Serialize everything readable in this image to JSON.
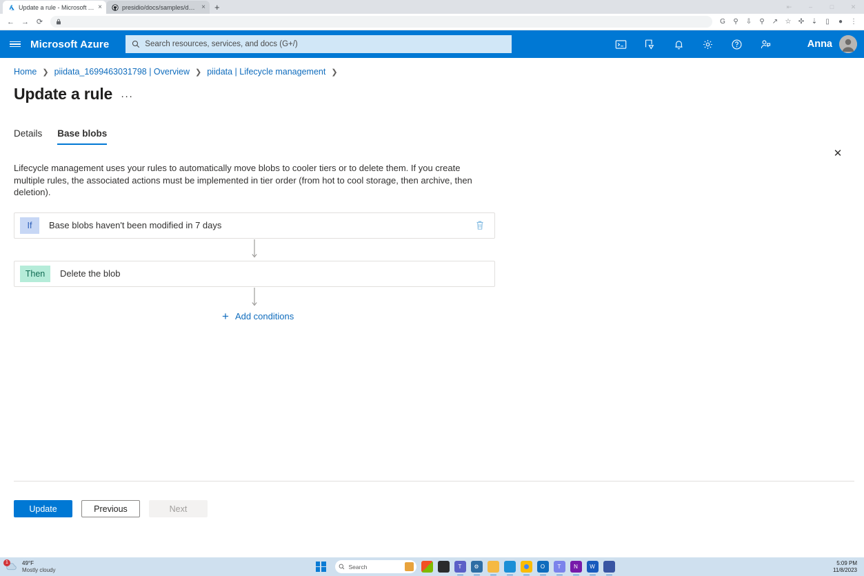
{
  "browser": {
    "tabs": [
      {
        "title": "Update a rule - Microsoft Azure",
        "favicon": "azure-icon",
        "active": true
      },
      {
        "title": "presidio/docs/samples/deploy",
        "favicon": "github-icon",
        "active": false
      }
    ],
    "new_tab_label": "+",
    "close_label": "×",
    "nav": {
      "back": "←",
      "forward": "→",
      "reload": "⟳",
      "lock": "lock-icon"
    },
    "omnibox_value": "",
    "omnibox_placeholder": "",
    "right_icons": [
      "google-icon",
      "key-icon",
      "install-icon",
      "zoom-icon",
      "share-icon",
      "bookmark-star-icon",
      "extensions-icon",
      "downloads-icon",
      "sidepanel-icon",
      "profile-icon",
      "menu-icon"
    ],
    "window_controls": [
      "restore",
      "minimize",
      "maximize",
      "close"
    ]
  },
  "azure_header": {
    "menu_icon": "hamburger-icon",
    "brand": "Microsoft Azure",
    "search_placeholder": "Search resources, services, and docs (G+/)",
    "icons": [
      "cloud-shell-icon",
      "directories-subscriptions-icon",
      "notifications-bell-icon",
      "settings-gear-icon",
      "help-question-icon",
      "feedback-icon"
    ],
    "username": "Anna",
    "accent_color": "#0078d4"
  },
  "breadcrumb": [
    "Home",
    "piidata_1699463031798 | Overview",
    "piidata | Lifecycle management"
  ],
  "page": {
    "title": "Update a rule",
    "ellipsis": "···",
    "close": "✕"
  },
  "tabs": [
    {
      "label": "Details",
      "selected": false
    },
    {
      "label": "Base blobs",
      "selected": true
    }
  ],
  "description": "Lifecycle management uses your rules to automatically move blobs to cooler tiers or to delete them. If you create multiple rules, the associated actions must be implemented in tier order (from hot to cool storage, then archive, then deletion).",
  "rules": {
    "if": {
      "badge": "If",
      "text": "Base blobs haven't been modified in 7 days",
      "badge_bg": "#c7d7f5",
      "badge_fg": "#2b5eb8",
      "delete_icon": "trash-icon"
    },
    "then": {
      "badge": "Then",
      "text": "Delete the blob",
      "badge_bg": "#b5ecd9",
      "badge_fg": "#0f6b52"
    },
    "add_conditions": {
      "label": "Add conditions",
      "icon": "plus-icon",
      "color": "#0f6cbd"
    }
  },
  "footer": {
    "update": "Update",
    "previous": "Previous",
    "next": "Next"
  },
  "taskbar": {
    "weather": {
      "temp": "49°F",
      "condition": "Mostly cloudy",
      "badge": "1"
    },
    "start_icon": "windows-start-icon",
    "search_placeholder": "Search",
    "apps": [
      "copilot-icon",
      "file-explorer-dark-icon",
      "teams-icon",
      "settings-icon",
      "file-explorer-icon",
      "edge-icon",
      "chrome-icon",
      "outlook-icon",
      "teams-work-icon",
      "onenote-icon",
      "word-icon",
      "visio-icon"
    ],
    "clock": {
      "time": "5:09 PM",
      "date": "11/8/2023"
    }
  }
}
